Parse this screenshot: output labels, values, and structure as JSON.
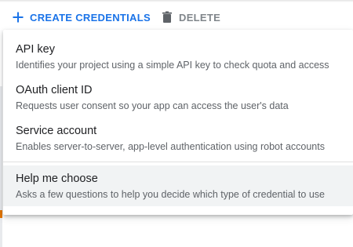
{
  "toolbar": {
    "create_label": "CREATE CREDENTIALS",
    "delete_label": "DELETE",
    "create_icon": "plus-icon",
    "delete_icon": "trash-icon",
    "accent_color": "#1a73e8",
    "disabled_color": "#80868b"
  },
  "menu": {
    "items": [
      {
        "title": "API key",
        "description": "Identifies your project using a simple API key to check quota and access"
      },
      {
        "title": "OAuth client ID",
        "description": "Requests user consent so your app can access the user's data"
      },
      {
        "title": "Service account",
        "description": "Enables server-to-server, app-level authentication using robot accounts"
      }
    ],
    "help": {
      "title": "Help me choose",
      "description": "Asks a few questions to help you decide which type of credential to use"
    }
  }
}
